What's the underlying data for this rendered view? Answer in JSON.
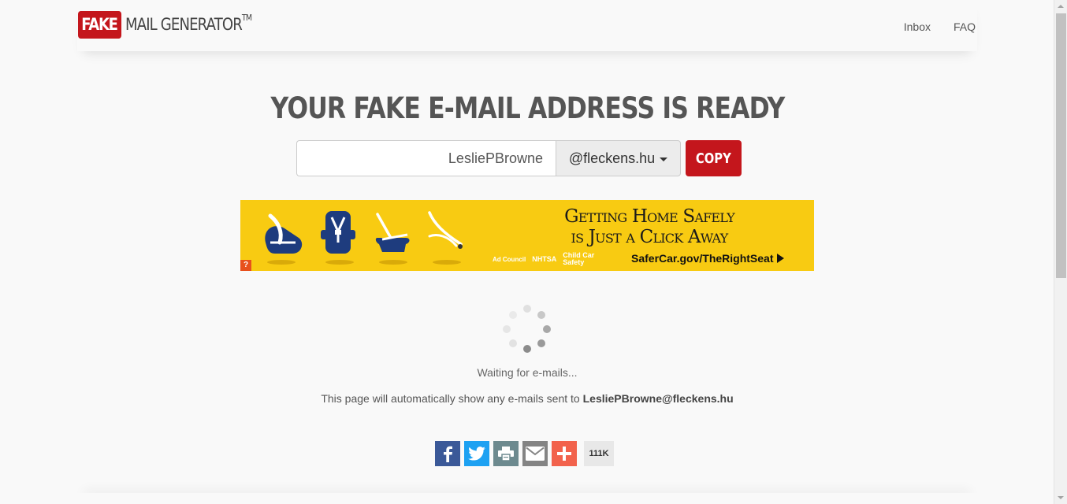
{
  "header": {
    "logo": {
      "badge": "FAKE",
      "text": "MAIL GENERATOR",
      "trademark": "TM"
    },
    "nav": [
      {
        "label": "Inbox"
      },
      {
        "label": "FAQ"
      }
    ]
  },
  "main": {
    "title": "YOUR FAKE E-MAIL ADDRESS IS READY",
    "email": {
      "username_value": "LesliePBrowne",
      "domain_selected": "@fleckens.hu",
      "copy_label": "COPY"
    },
    "ad": {
      "headline_line1": "Getting Home Safely",
      "headline_line2": "is Just a Click Away",
      "url": "SaferCar.gov/TheRightSeat",
      "sponsor_logos": [
        "Ad Council",
        "NHTSA",
        "Child Car Safety"
      ],
      "info_badge": "?"
    },
    "status": {
      "waiting": "Waiting for e-mails...",
      "note_prefix": "This page will automatically show any e-mails sent to",
      "note_address": "LesliePBrowne@fleckens.hu"
    },
    "share": {
      "buttons": [
        {
          "name": "facebook",
          "icon": "facebook-icon",
          "color": "#3b5998"
        },
        {
          "name": "twitter",
          "icon": "twitter-icon",
          "color": "#1da1f2"
        },
        {
          "name": "print",
          "icon": "print-icon",
          "color": "#6d8a8f"
        },
        {
          "name": "email",
          "icon": "email-icon",
          "color": "#848484"
        },
        {
          "name": "more",
          "icon": "plus-icon",
          "color": "#f2624c"
        }
      ],
      "count": "111K"
    }
  },
  "colors": {
    "brand_red": "#c4161c",
    "ad_yellow": "#f8cb12",
    "ad_navy": "#1e3c7e",
    "background": "#f9f9f9"
  }
}
